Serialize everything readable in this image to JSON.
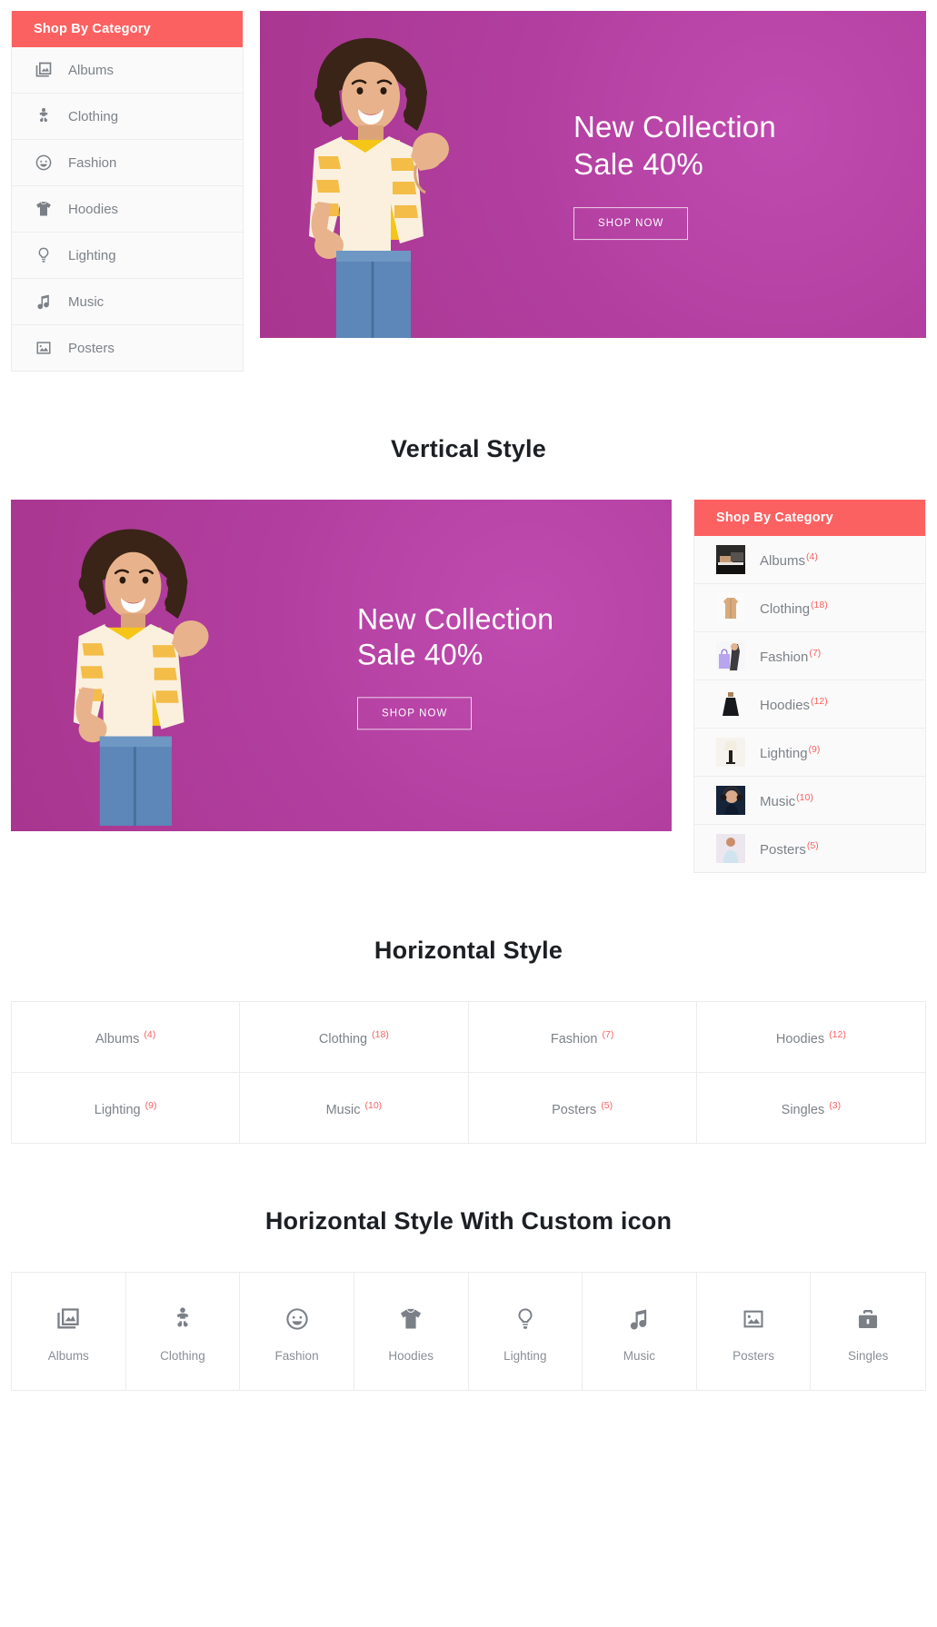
{
  "sidebar_icons": {
    "header": "Shop By Category",
    "items": [
      {
        "label": "Albums",
        "icon": "albums-icon"
      },
      {
        "label": "Clothing",
        "icon": "baby-clothing-icon"
      },
      {
        "label": "Fashion",
        "icon": "smiley-face-icon"
      },
      {
        "label": "Hoodies",
        "icon": "tshirt-icon"
      },
      {
        "label": "Lighting",
        "icon": "lightbulb-icon"
      },
      {
        "label": "Music",
        "icon": "music-note-icon"
      },
      {
        "label": "Posters",
        "icon": "poster-icon"
      }
    ]
  },
  "banner": {
    "title": "New Collection\nSale 40%",
    "button": "SHOP NOW"
  },
  "sections": {
    "vertical": "Vertical Style",
    "horizontal": "Horizontal Style",
    "horizontal_custom": "Horizontal Style With Custom icon"
  },
  "sidebar_vertical": {
    "header": "Shop By Category",
    "items": [
      {
        "label": "Albums",
        "count": "(4)",
        "thumb": "albums-thumb"
      },
      {
        "label": "Clothing",
        "count": "(18)",
        "thumb": "clothing-thumb"
      },
      {
        "label": "Fashion",
        "count": "(7)",
        "thumb": "fashion-thumb"
      },
      {
        "label": "Hoodies",
        "count": "(12)",
        "thumb": "hoodies-thumb"
      },
      {
        "label": "Lighting",
        "count": "(9)",
        "thumb": "lighting-thumb"
      },
      {
        "label": "Music",
        "count": "(10)",
        "thumb": "music-thumb"
      },
      {
        "label": "Posters",
        "count": "(5)",
        "thumb": "posters-thumb"
      }
    ]
  },
  "horizontal_grid": {
    "items": [
      {
        "label": "Albums",
        "count": "(4)",
        "thumb": "albums-thumb"
      },
      {
        "label": "Clothing",
        "count": "(18)",
        "thumb": "clothing-thumb"
      },
      {
        "label": "Fashion",
        "count": "(7)",
        "thumb": "fashion-thumb"
      },
      {
        "label": "Hoodies",
        "count": "(12)",
        "thumb": "hoodies-thumb"
      },
      {
        "label": "Lighting",
        "count": "(9)",
        "thumb": "lighting-thumb"
      },
      {
        "label": "Music",
        "count": "(10)",
        "thumb": "music-thumb"
      },
      {
        "label": "Posters",
        "count": "(5)",
        "thumb": "posters-thumb"
      },
      {
        "label": "Singles",
        "count": "(3)",
        "thumb": "singles-thumb"
      }
    ]
  },
  "icon_row": {
    "items": [
      {
        "label": "Albums",
        "icon": "albums-icon"
      },
      {
        "label": "Clothing",
        "icon": "baby-clothing-icon"
      },
      {
        "label": "Fashion",
        "icon": "smiley-face-icon"
      },
      {
        "label": "Hoodies",
        "icon": "tshirt-icon"
      },
      {
        "label": "Lighting",
        "icon": "lightbulb-icon"
      },
      {
        "label": "Music",
        "icon": "music-note-icon"
      },
      {
        "label": "Posters",
        "icon": "poster-icon"
      },
      {
        "label": "Singles",
        "icon": "briefcase-icon"
      }
    ]
  },
  "colors": {
    "accent": "#fc6161",
    "banner_bg": "#b23fa0",
    "text": "#7d8288",
    "heading": "#1c1f23"
  }
}
